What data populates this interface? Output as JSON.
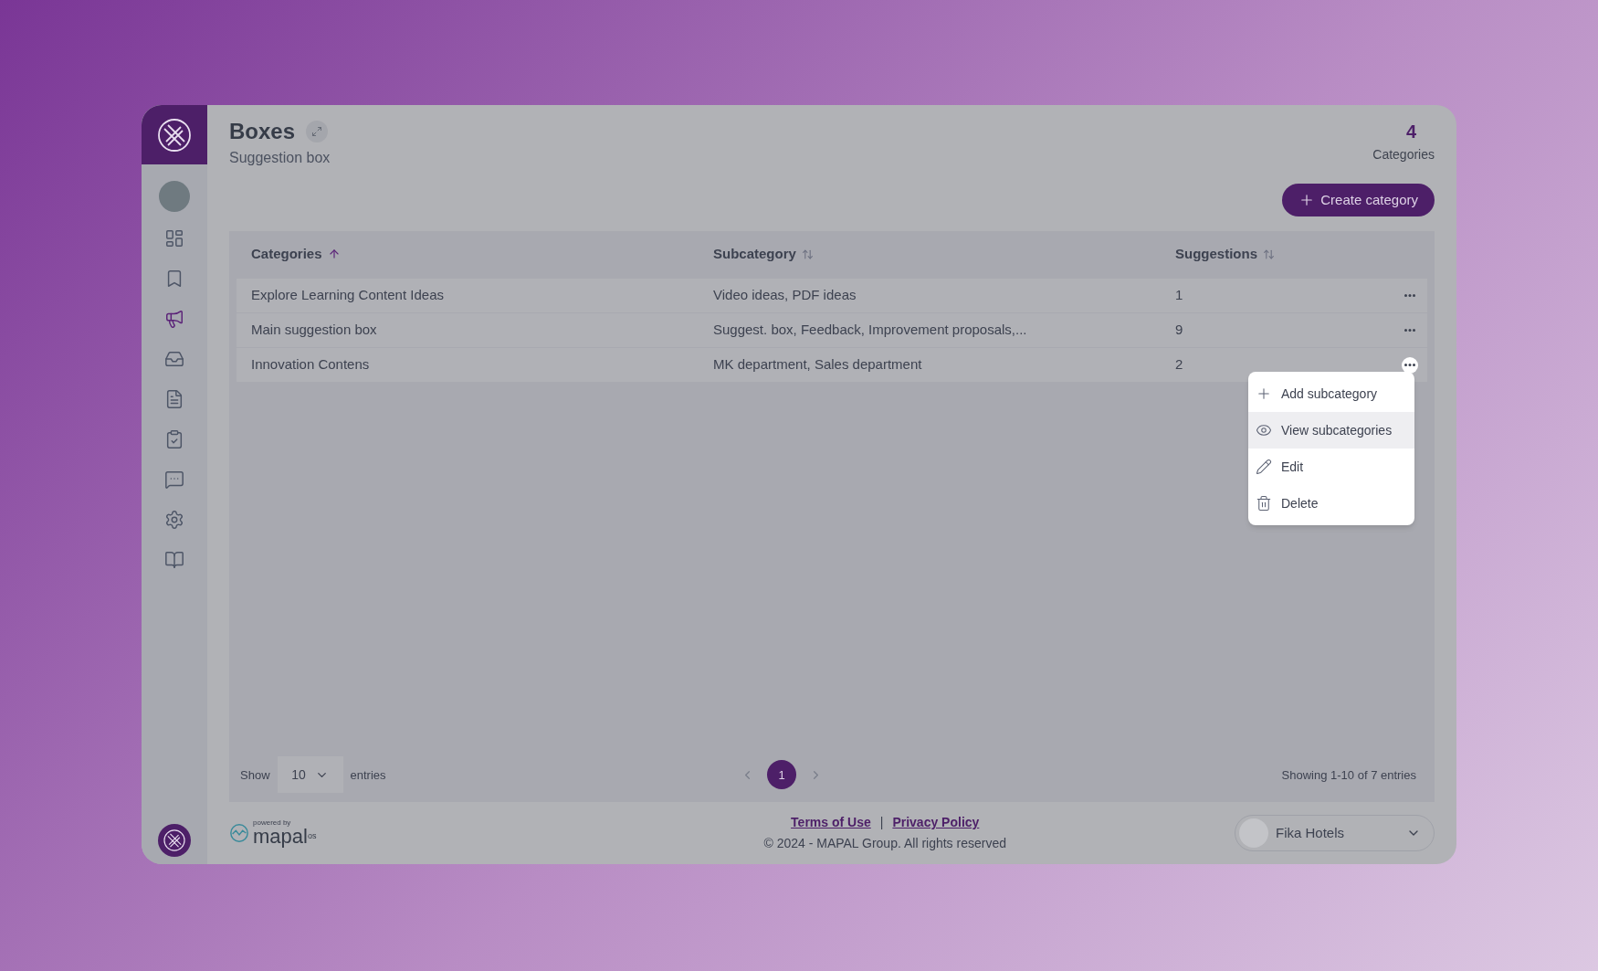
{
  "sidebar": {
    "items": [
      {
        "kind": "dashboard",
        "selected": false
      },
      {
        "kind": "bookmark",
        "selected": false
      },
      {
        "kind": "megaphone",
        "selected": true
      },
      {
        "kind": "inbox",
        "selected": false
      },
      {
        "kind": "document",
        "selected": false
      },
      {
        "kind": "clipboard",
        "selected": false
      },
      {
        "kind": "chat",
        "selected": false
      },
      {
        "kind": "settings",
        "selected": false
      },
      {
        "kind": "book",
        "selected": false
      }
    ]
  },
  "header": {
    "title": "Boxes",
    "subtitle": "Suggestion box",
    "count": "4",
    "count_label": "Categories"
  },
  "create_button": {
    "label": "Create category"
  },
  "table": {
    "columns": [
      {
        "label": "Categories",
        "sorted": true
      },
      {
        "label": "Subcategory",
        "sorted": false
      },
      {
        "label": "Suggestions",
        "sorted": false
      }
    ],
    "rows": [
      {
        "category": "Explore Learning Content Ideas",
        "subcategory": "Video ideas, PDF ideas",
        "suggestions": "1",
        "menu_open": false
      },
      {
        "category": "Main suggestion box",
        "subcategory": "Suggest. box, Feedback, Improvement proposals,...",
        "suggestions": "9",
        "menu_open": false
      },
      {
        "category": "Innovation Contens",
        "subcategory": "MK department, Sales department",
        "suggestions": "2",
        "menu_open": true
      }
    ]
  },
  "row_menu": {
    "items": [
      {
        "kind": "add",
        "label": "Add subcategory",
        "selected": false
      },
      {
        "kind": "view",
        "label": "View subcategories",
        "selected": true
      },
      {
        "kind": "edit",
        "label": "Edit",
        "selected": false
      },
      {
        "kind": "delete",
        "label": "Delete",
        "selected": false
      }
    ]
  },
  "pagination": {
    "show_label": "Show",
    "page_size": "10",
    "entries_label": "entries",
    "pages": [
      {
        "label": "1",
        "selected": true
      }
    ],
    "summary": "Showing 1-10 of 7 entries"
  },
  "footer": {
    "powered_by": "powered by",
    "brand": "mapal",
    "brand_suffix": "os",
    "links": [
      {
        "label": "Terms of Use"
      },
      {
        "label": "Privacy Policy"
      }
    ],
    "separator": "|",
    "copyright": "© 2024 - MAPAL Group. All rights reserved",
    "organization": "Fika Hotels"
  }
}
